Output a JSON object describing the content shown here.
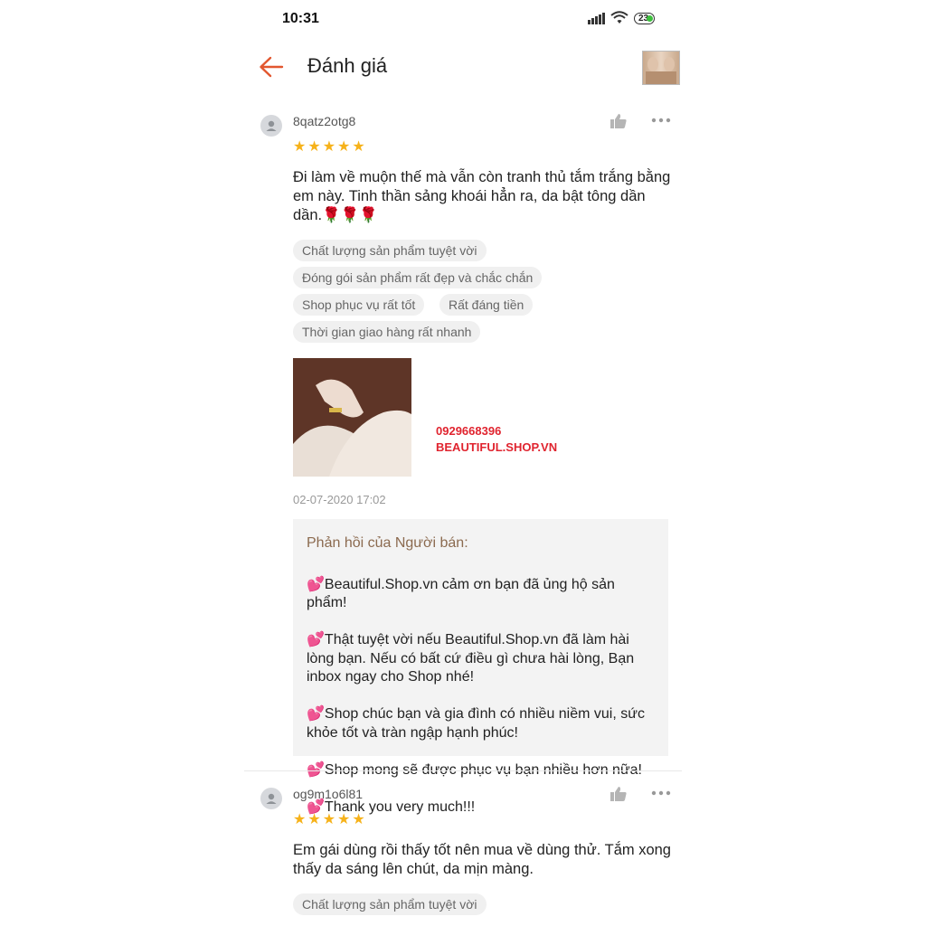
{
  "status_bar": {
    "time": "10:31",
    "battery": "23"
  },
  "header": {
    "title": "Đánh giá",
    "back_icon": "arrow-left-icon",
    "product_thumb": "product-thumbnail"
  },
  "colors": {
    "accent": "#e2572f",
    "star": "#f6b21a",
    "reply_title": "#8b6a4f",
    "overlay_text": "#e0242f"
  },
  "reviews": [
    {
      "username": "8qatz2otg8",
      "stars": "★★★★★",
      "text": "Đi làm về muộn thế mà vẫn còn tranh thủ tắm trắng bằng em này. Tinh thần sảng khoái hẳn ra, da bật tông dần dần.🌹🌹🌹",
      "tags": [
        "Chất lượng sản phẩm tuyệt vời",
        "Đóng gói sản phẩm rất đẹp và chắc chắn",
        "Shop phục vụ rất tốt",
        "Rất đáng tiền",
        "Thời gian giao hàng rất nhanh"
      ],
      "image_overlay": {
        "phone": "0929668396",
        "site": "BEAUTIFUL.SHOP.VN"
      },
      "date": "02-07-2020 17:02",
      "seller_reply": {
        "title": "Phản hồi của Người bán:",
        "lines": [
          "💕Beautiful.Shop.vn cảm ơn bạn đã ủng hộ sản phẩm!",
          "💕Thật tuyệt vời nếu Beautiful.Shop.vn đã làm hài lòng bạn. Nếu có bất cứ điều gì chưa hài lòng, Bạn inbox ngay cho Shop nhé!",
          "💕Shop chúc bạn và gia đình có nhiều niềm vui, sức khỏe tốt và tràn ngập hạnh phúc!",
          "💕Shop mong sẽ được phục vụ bạn nhiều hơn nữa!",
          "💕Thank you very much!!!"
        ]
      }
    },
    {
      "username": "og9m1o6l81",
      "stars": "★★★★★",
      "text": "Em gái dùng rồi thấy tốt nên mua về dùng thử. Tắm xong thấy da sáng lên chút, da mịn màng.",
      "tags": [
        "Chất lượng sản phẩm tuyệt vời"
      ]
    }
  ]
}
